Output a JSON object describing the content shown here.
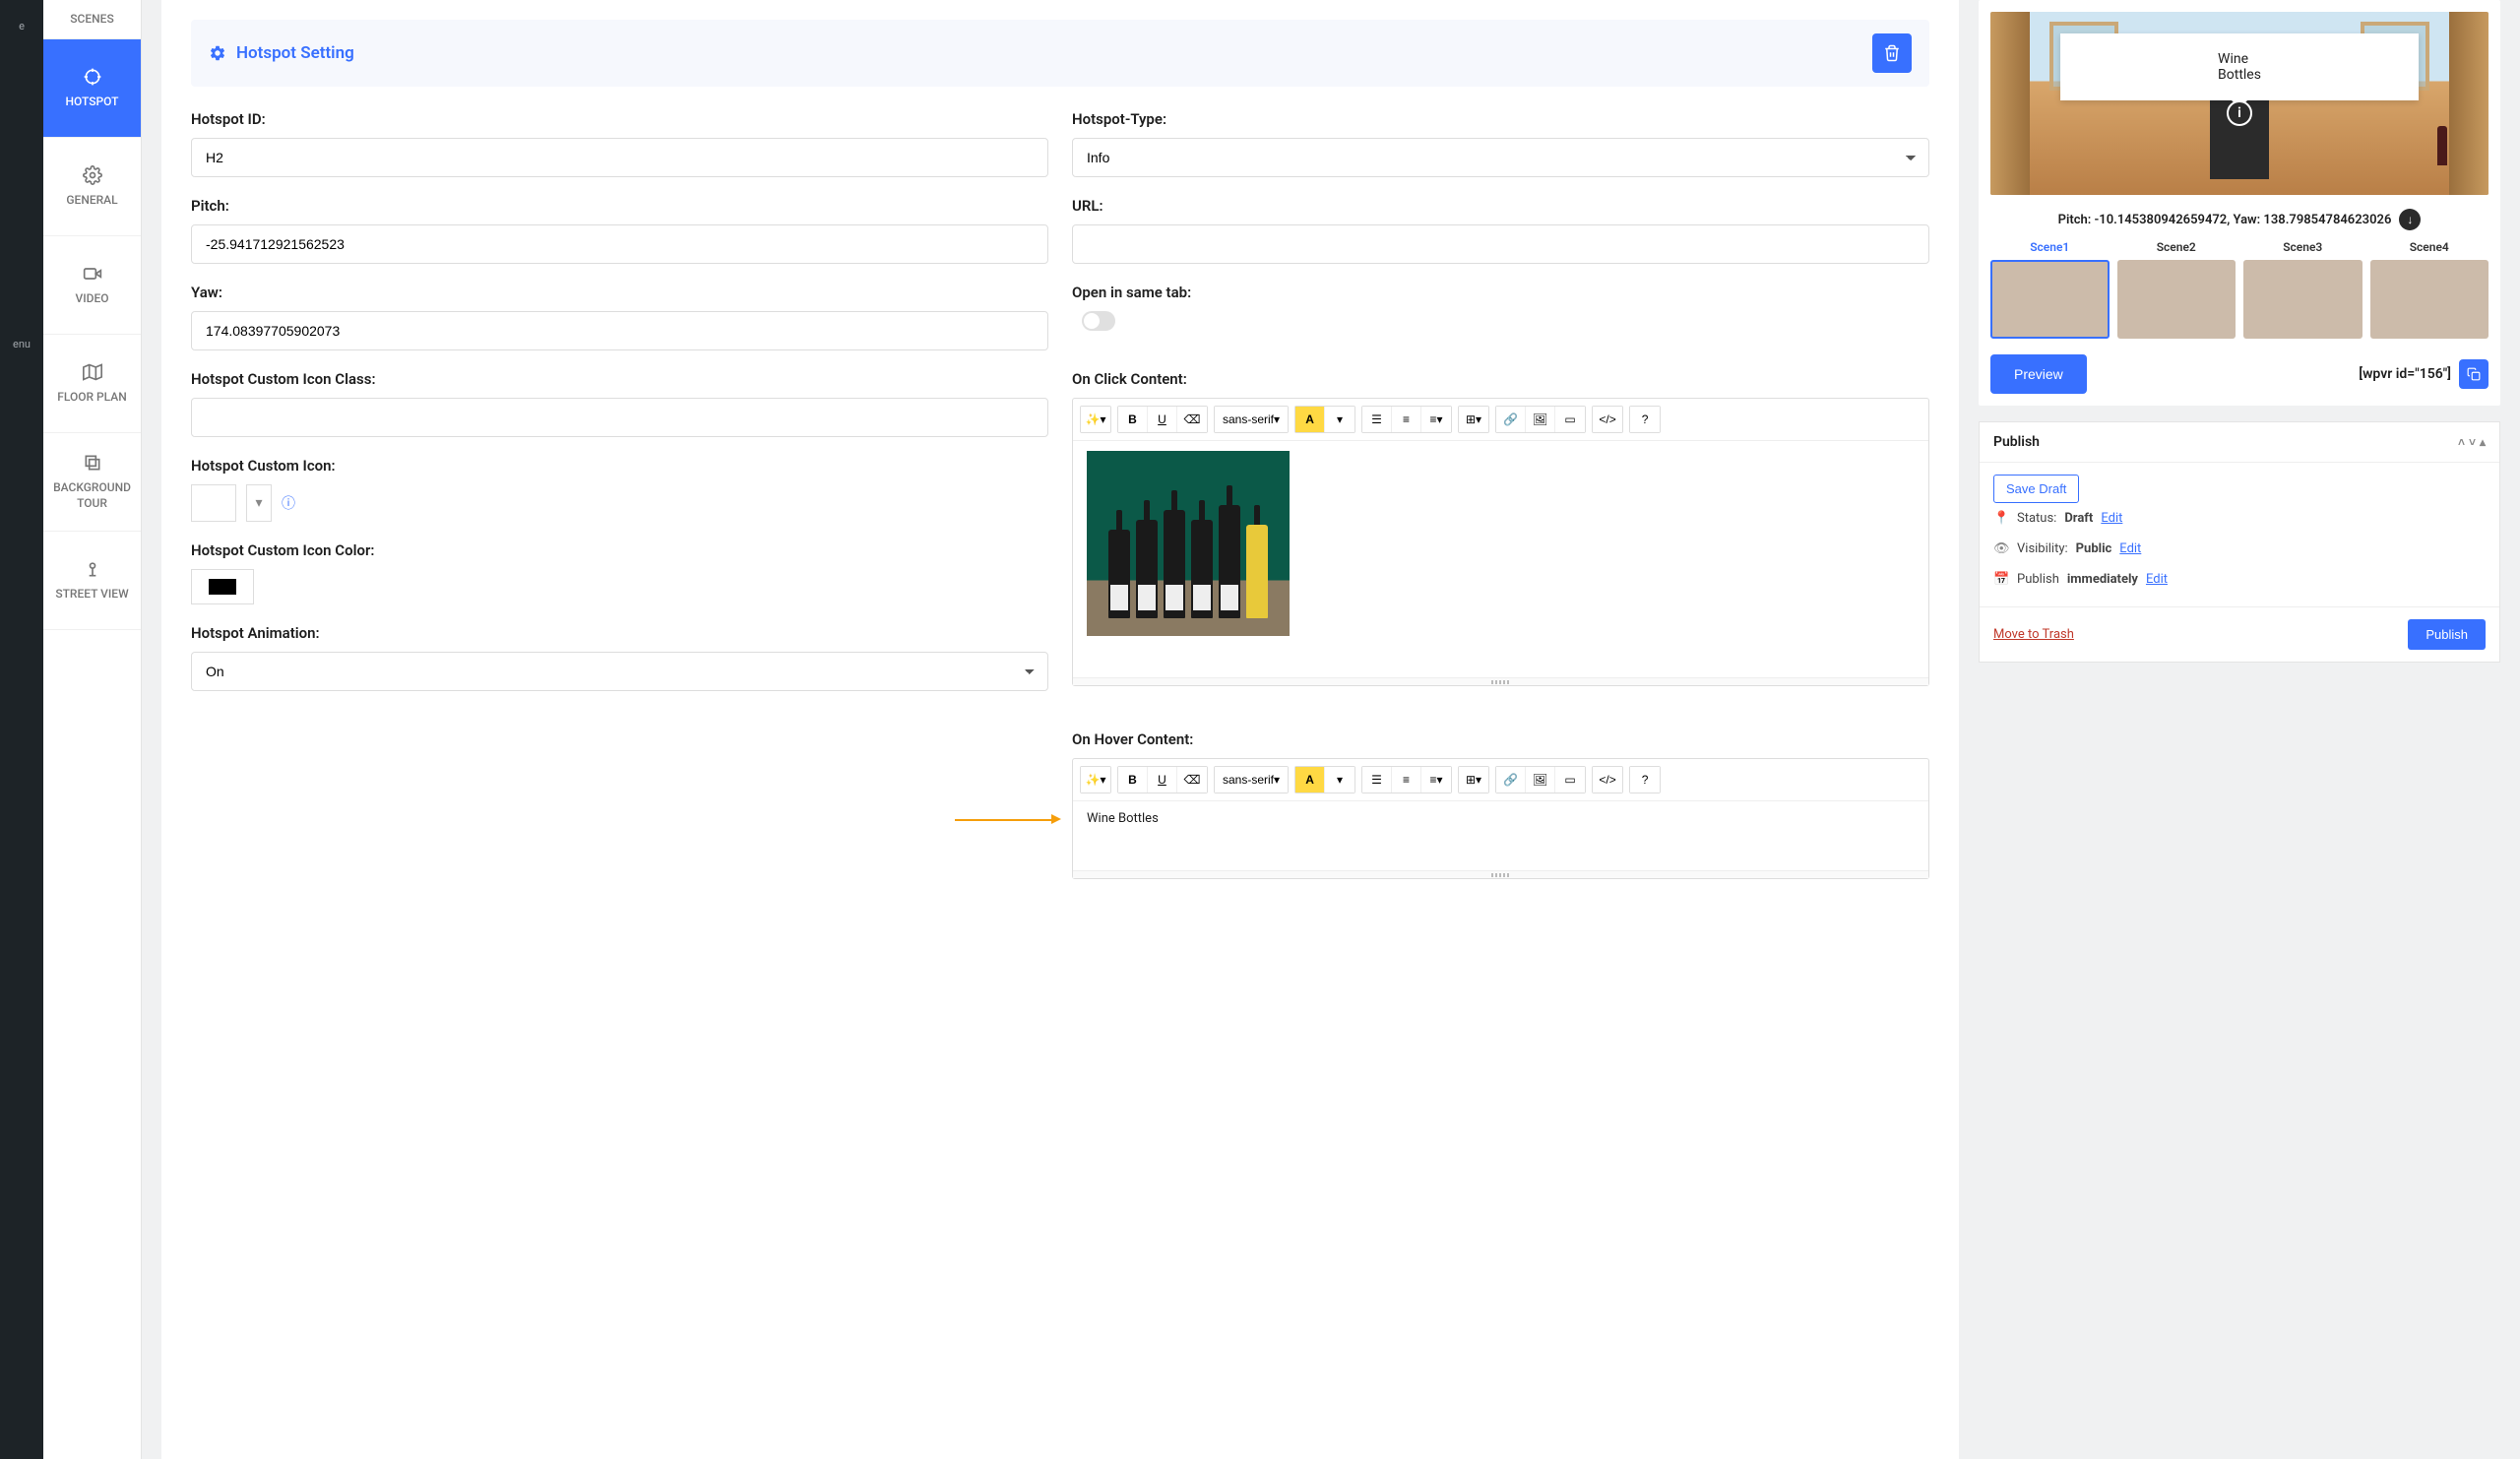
{
  "adminbar": {
    "item1": "e",
    "item2": "enu"
  },
  "tabs": {
    "scenes": "SCENES",
    "hotspot": "HOTSPOT",
    "general": "GENERAL",
    "video": "VIDEO",
    "floorplan": "FLOOR PLAN",
    "bgtour": "BACKGROUND TOUR",
    "streetview": "STREET VIEW"
  },
  "section": {
    "title": "Hotspot Setting"
  },
  "labels": {
    "hotspot_id": "Hotspot ID:",
    "hotspot_type": "Hotspot-Type:",
    "pitch": "Pitch:",
    "url": "URL:",
    "yaw": "Yaw:",
    "open_same_tab": "Open in same tab:",
    "on_click": "On Click Content:",
    "icon_class": "Hotspot Custom Icon Class:",
    "icon": "Hotspot Custom Icon:",
    "icon_color": "Hotspot Custom Icon Color:",
    "animation": "Hotspot Animation:",
    "on_hover": "On Hover Content:"
  },
  "values": {
    "hotspot_id": "H2",
    "hotspot_type": "Info",
    "pitch": "-25.941712921562523",
    "yaw": "174.08397705902073",
    "url": "",
    "icon_class": "",
    "animation": "On",
    "hover_text": "Wine Bottles"
  },
  "rte": {
    "font": "sans-serif"
  },
  "preview": {
    "tooltip": "Wine Bottles",
    "coords": "Pitch: -10.145380942659472, Yaw: 138.79854784623026",
    "scenes": [
      "Scene1",
      "Scene2",
      "Scene3",
      "Scene4"
    ],
    "preview_btn": "Preview",
    "shortcode": "[wpvr id=\"156\"]"
  },
  "publish": {
    "title": "Publish",
    "save_draft": "Save Draft",
    "status_label": "Status:",
    "status_value": "Draft",
    "visibility_label": "Visibility:",
    "visibility_value": "Public",
    "schedule_label": "Publish",
    "schedule_value": "immediately",
    "edit": "Edit",
    "trash": "Move to Trash",
    "publish_btn": "Publish"
  }
}
